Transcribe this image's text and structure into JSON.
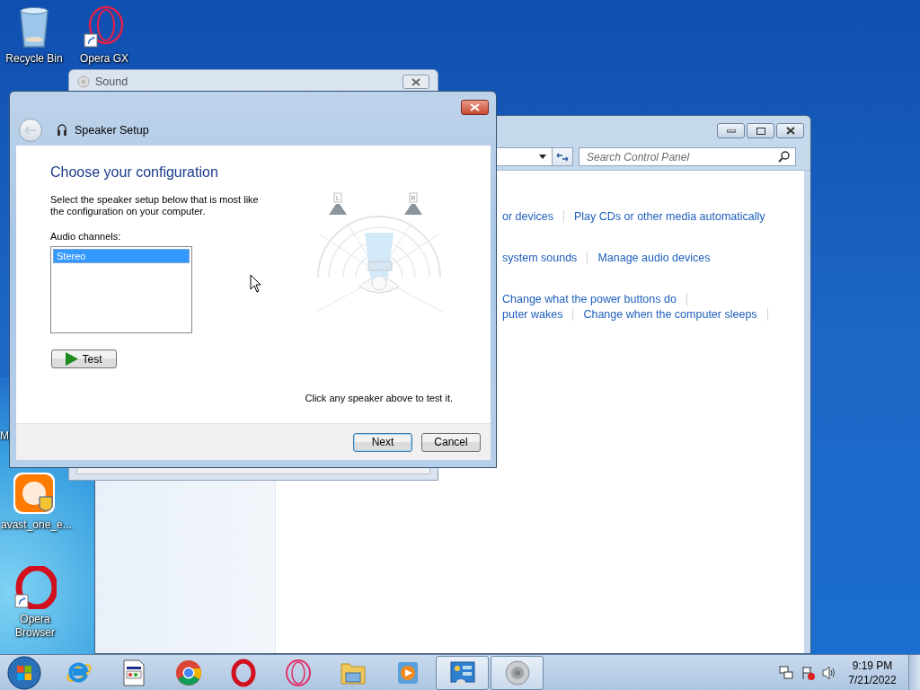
{
  "desktop_icons": [
    {
      "kind": "recycle_bin",
      "label": "Recycle Bin"
    },
    {
      "kind": "opera_gx",
      "label": "Opera GX"
    },
    {
      "kind": "covered",
      "label": "M"
    },
    {
      "kind": "avast",
      "label": "avast_one_e..."
    },
    {
      "kind": "opera",
      "label": "Opera Browser"
    }
  ],
  "control_panel": {
    "search": {
      "placeholder": "Search Control Panel"
    },
    "link_groups": [
      {
        "rows": [
          {
            "links": [
              "or devices",
              "Play CDs or other media automatically"
            ],
            "trailing_divider": false
          }
        ]
      },
      {
        "rows": [
          {
            "links": [
              "system sounds",
              "Manage audio devices"
            ],
            "trailing_divider": false
          }
        ]
      },
      {
        "rows": [
          {
            "links": [
              "Change what the power buttons do"
            ],
            "trailing_divider": true
          },
          {
            "links": [
              "puter wakes",
              "Change when the computer sleeps"
            ],
            "trailing_divider": true
          }
        ]
      }
    ]
  },
  "sound_window": {
    "title": "Sound"
  },
  "dialog": {
    "title": "Speaker Setup",
    "heading": "Choose your configuration",
    "instructions": "Select the speaker setup below that is most like the configuration on your computer.",
    "list_label": "Audio channels:",
    "channels": [
      {
        "label": "Stereo",
        "selected": true
      }
    ],
    "test_button": "Test",
    "speaker_labels": [
      "L",
      "R"
    ],
    "hint": "Click any speaker above to test it.",
    "buttons": [
      {
        "label": "Next",
        "default": true
      },
      {
        "label": "Cancel",
        "default": false
      }
    ]
  },
  "taskbar": {
    "apps": [
      {
        "kind": "ie",
        "active": false
      },
      {
        "kind": "document",
        "active": false
      },
      {
        "kind": "chrome",
        "active": false
      },
      {
        "kind": "opera",
        "active": false
      },
      {
        "kind": "opera_gx",
        "active": false
      },
      {
        "kind": "folder",
        "active": false
      },
      {
        "kind": "media",
        "active": false
      },
      {
        "kind": "control_panel",
        "active": true
      },
      {
        "kind": "speaker",
        "active": true
      }
    ],
    "clock": {
      "time": "9:19 PM",
      "date": "7/21/2022"
    }
  }
}
